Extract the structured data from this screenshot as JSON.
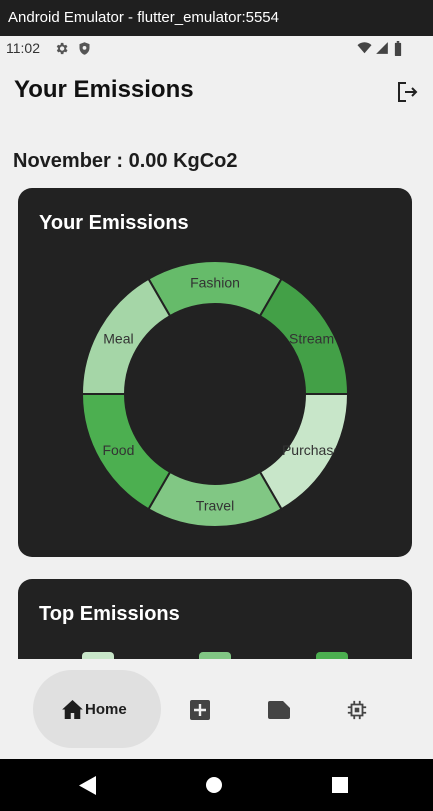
{
  "window": {
    "title": "Android Emulator - flutter_emulator:5554"
  },
  "status": {
    "time": "11:02"
  },
  "appbar": {
    "title": "Your Emissions",
    "logout_icon": "logout-icon"
  },
  "summary": {
    "month_text": "November : 0.00 KgCo2"
  },
  "emissions_card": {
    "title": "Your Emissions"
  },
  "chart_data": {
    "type": "pie",
    "title": "Your Emissions",
    "labels": [
      "Fashion",
      "Stream",
      "Purchase",
      "Travel",
      "Food",
      "Meal"
    ],
    "values": [
      1,
      1,
      1,
      1,
      1,
      1
    ],
    "colors": [
      "#66bb6a",
      "#43a047",
      "#c8e6c9",
      "#81c784",
      "#4caf50",
      "#a5d6a7"
    ]
  },
  "top_card": {
    "title": "Top Emissions"
  },
  "top_bar_colors": [
    "#c8e6c9",
    "#81c784",
    "#4caf50"
  ],
  "nav": {
    "home_label": "Home",
    "items": [
      "home-icon",
      "add-box-icon",
      "label-icon",
      "memory-icon"
    ]
  }
}
